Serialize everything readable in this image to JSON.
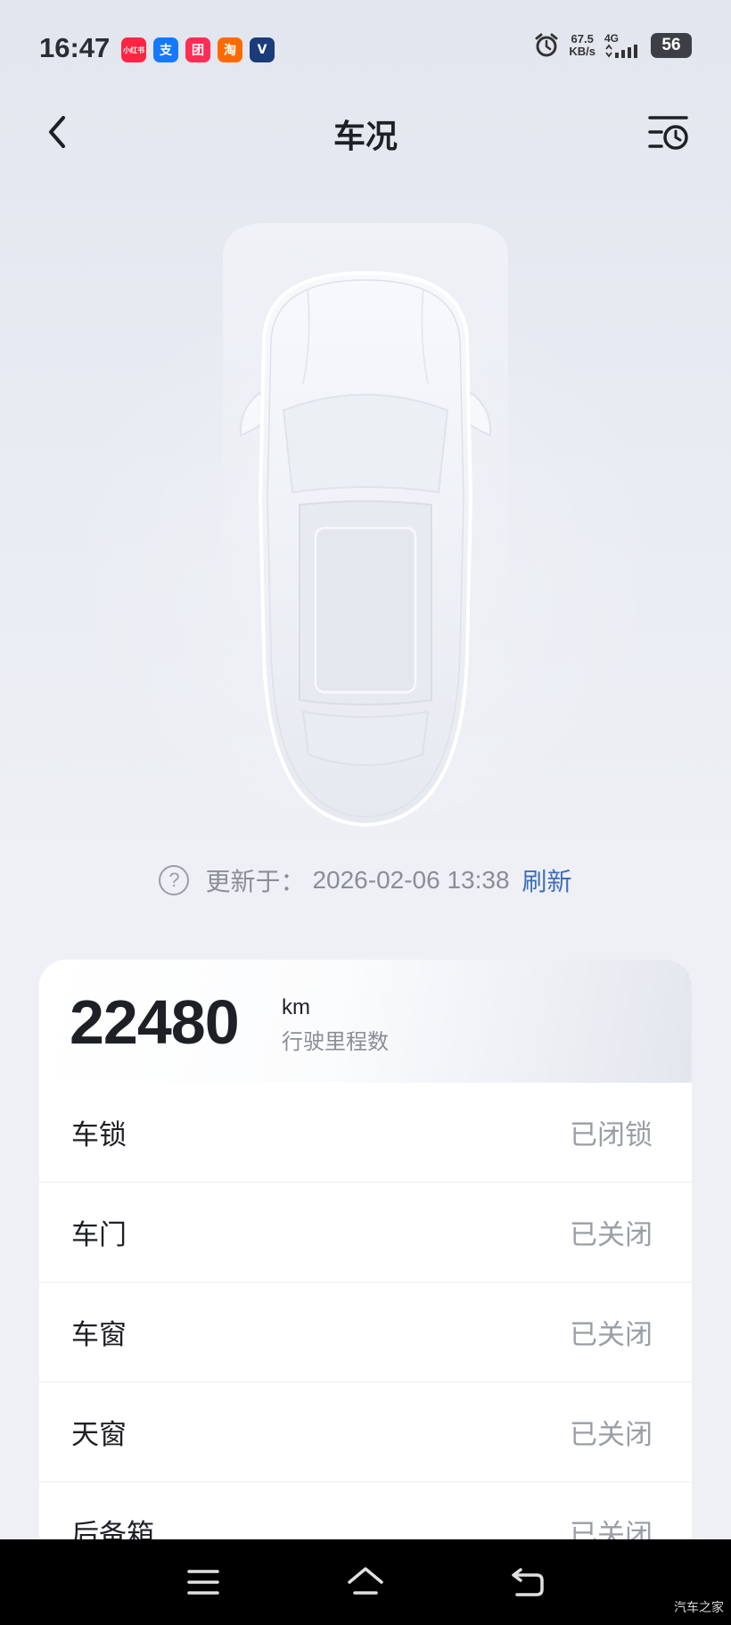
{
  "status_bar": {
    "time": "16:47",
    "apps": [
      {
        "name": "xiaohongshu-app-icon",
        "glyph": "小红书",
        "color": "#ff2442"
      },
      {
        "name": "alipay-app-icon",
        "glyph": "支",
        "color": "#1677ff"
      },
      {
        "name": "meituan-group-app-icon",
        "glyph": "团",
        "color": "#ff2d55"
      },
      {
        "name": "taobao-app-icon",
        "glyph": "淘",
        "color": "#ff6a00"
      },
      {
        "name": "changan-app-icon",
        "glyph": "V",
        "color": "#1b3b7a"
      }
    ],
    "net_speed_value": "67.5",
    "net_speed_unit": "KB/s",
    "net_type": "4G",
    "battery": "56"
  },
  "nav": {
    "title": "车况"
  },
  "update": {
    "prefix": "更新于：",
    "time": "2026-02-06 13:38",
    "refresh": "刷新"
  },
  "mileage": {
    "value": "22480",
    "unit": "km",
    "label": "行驶里程数"
  },
  "status_items": [
    {
      "label": "车锁",
      "value": "已闭锁"
    },
    {
      "label": "车门",
      "value": "已关闭"
    },
    {
      "label": "车窗",
      "value": "已关闭"
    },
    {
      "label": "天窗",
      "value": "已关闭"
    },
    {
      "label": "后备箱",
      "value": "已关闭"
    }
  ],
  "watermark": "汽车之家",
  "colors": {
    "accent": "#3b6fb6",
    "value_gray": "#9a9ea7",
    "title": "#1e2026"
  }
}
